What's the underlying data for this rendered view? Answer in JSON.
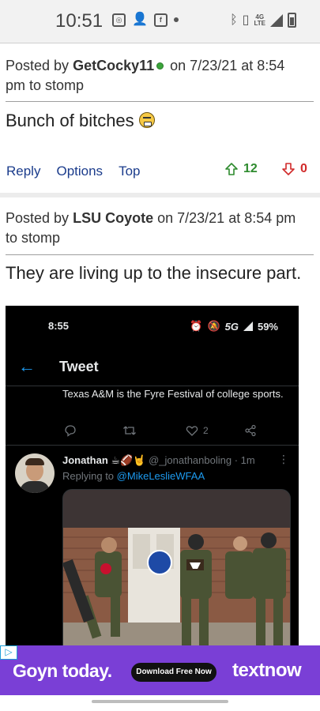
{
  "status_bar": {
    "time": "10:51",
    "left_icons": [
      "screen-record-icon",
      "add-person-icon",
      "facebook-icon",
      "dot-icon"
    ],
    "right_icons": [
      "bluetooth-icon",
      "vibrate-icon",
      "lte-signal-icon",
      "battery-icon"
    ],
    "network_top": "4G",
    "network_bottom": "LTE"
  },
  "posts": [
    {
      "prefix": "Posted by",
      "author": "GetCocky11",
      "online": true,
      "on_text": "on 7/23/21 at 8:54",
      "line2": "pm to stomp",
      "body": "Bunch of bitches",
      "body_emoji": "grimacing-face",
      "actions": {
        "reply": "Reply",
        "options": "Options",
        "top": "Top"
      },
      "upvotes": "12",
      "downvotes": "0"
    },
    {
      "prefix": "Posted by",
      "author": "LSU Coyote",
      "on_text": "on 7/23/21 at 8:54 pm",
      "line2": "to stomp",
      "body": "They are living up to the insecure part."
    }
  ],
  "embedded_tweet": {
    "status_time": "8:55",
    "status_network": "5G",
    "status_battery": "59%",
    "header_title": "Tweet",
    "quoted_text": "Texas A&M is the Fyre Festival of college sports.",
    "like_count": "2",
    "reply": {
      "name": "Jonathan",
      "name_emojis": "☕🏈🤘",
      "handle": "@_jonathanboling",
      "time": "· 1m",
      "replying_label": "Replying to",
      "replying_to": "@MikeLeslieWFAA"
    }
  },
  "ad": {
    "headline": "Goyn today.",
    "cta": "Download Free Now",
    "brand": "textnow",
    "color": "#7a3fd6"
  },
  "colors": {
    "link": "#1b3c8c",
    "upvote": "#2e8b2e",
    "downvote": "#d12a2a",
    "twitter_blue": "#1d9bf0"
  }
}
